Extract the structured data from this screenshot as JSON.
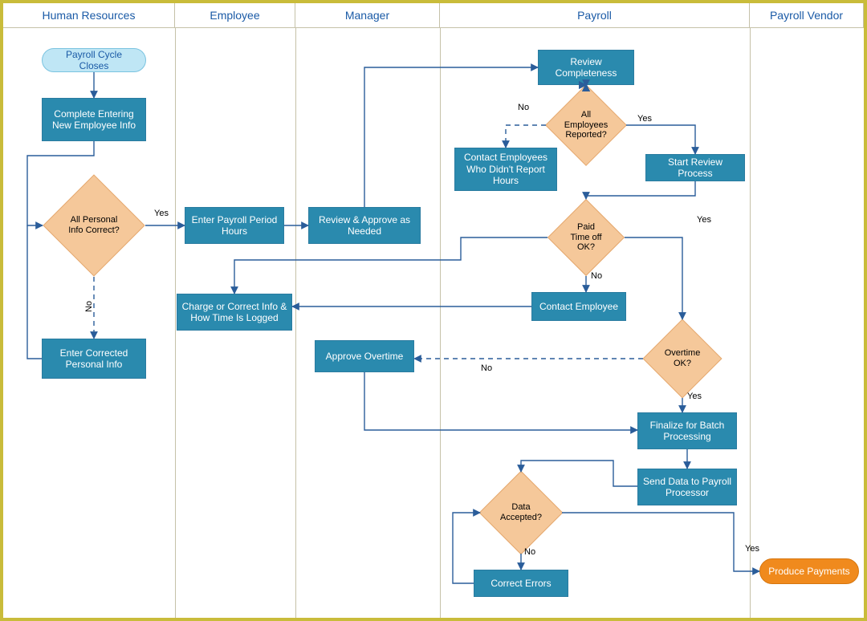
{
  "lanes": {
    "hr": {
      "title": "Human Resources"
    },
    "emp": {
      "title": "Employee"
    },
    "mgr": {
      "title": "Manager"
    },
    "payroll": {
      "title": "Payroll"
    },
    "vendor": {
      "title": "Payroll Vendor"
    }
  },
  "nodes": {
    "start": "Payroll Cycle Closes",
    "completeInfo": "Complete Entering New Employee Info",
    "allInfoCorrect": "All Personal Info Correct?",
    "enterCorrected": "Enter Corrected Personal Info",
    "enterHours": "Enter Payroll Period Hours",
    "chargeCorrect": "Charge or Correct Info & How Time Is Logged",
    "reviewApprove": "Review & Approve as Needed",
    "approveOvertime": "Approve Overtime",
    "reviewComplete": "Review Completeness",
    "allReported": "All Employees Reported?",
    "contactNonReport": "Contact Employees Who Didn't Report Hours",
    "startReview": "Start Review Process",
    "ptoOk": "Paid Time off OK?",
    "contactEmp": "Contact Employee",
    "otOk": "Overtime OK?",
    "finalize": "Finalize for Batch Processing",
    "sendData": "Send Data to Payroll Processor",
    "dataAccepted": "Data Accepted?",
    "correctErrors": "Correct Errors",
    "produce": "Produce Payments"
  },
  "labels": {
    "yes": "Yes",
    "no": "No"
  }
}
